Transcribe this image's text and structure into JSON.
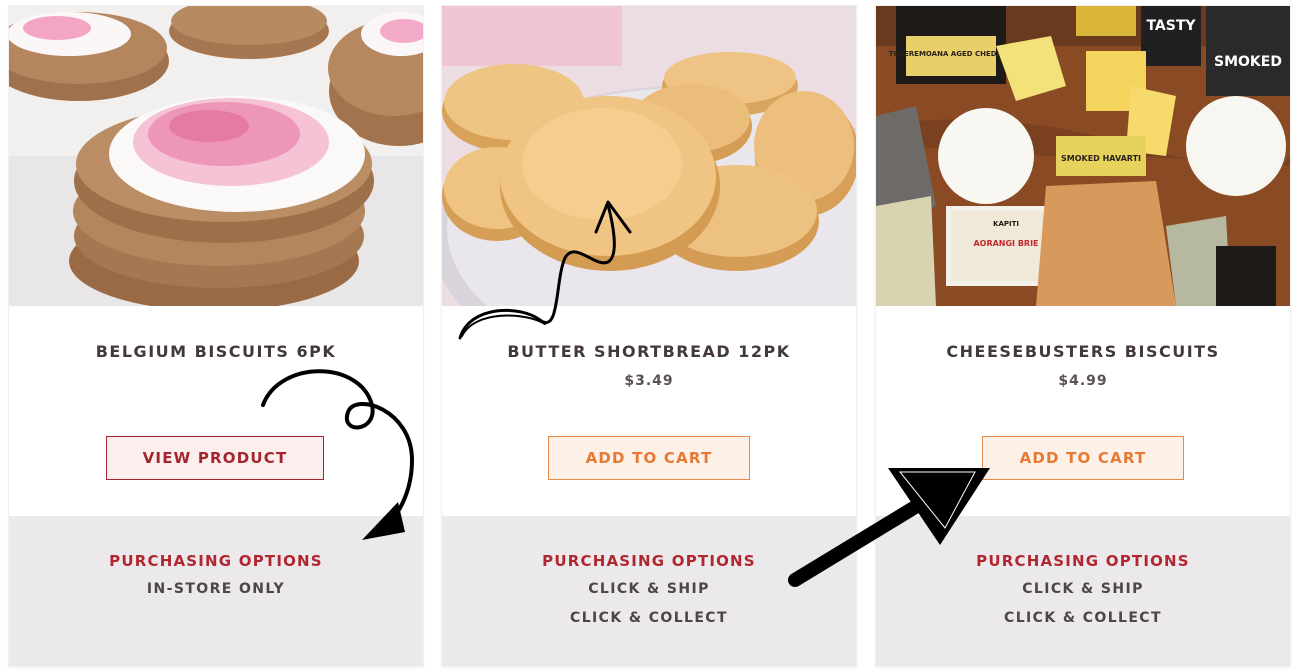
{
  "products": [
    {
      "name": "BELGIUM BISCUITS 6PK",
      "price": "",
      "button_label": "VIEW PRODUCT",
      "options_heading": "PURCHASING OPTIONS",
      "options": [
        "IN-STORE ONLY"
      ]
    },
    {
      "name": "BUTTER SHORTBREAD 12PK",
      "price": "$3.49",
      "button_label": "ADD TO CART",
      "options_heading": "PURCHASING OPTIONS",
      "options": [
        "CLICK & SHIP",
        "CLICK & COLLECT"
      ]
    },
    {
      "name": "CHEESEBUSTERS BISCUITS",
      "price": "$4.99",
      "button_label": "ADD TO CART",
      "options_heading": "PURCHASING OPTIONS",
      "options": [
        "CLICK & SHIP",
        "CLICK & COLLECT"
      ]
    }
  ],
  "image_labels": {
    "cheese_1": "TUTEREMOANA AGED CHEDDAR",
    "cheese_2": "SMOKED HAVARTI",
    "cheese_3": "AORANGI BRIE",
    "brand": "KAPITI",
    "box_1": "TASTY",
    "box_2": "SMOKED"
  },
  "colors": {
    "text_dark": "#43393a",
    "view_button": "#a3262e",
    "cart_button": "#e67a34",
    "options_heading": "#b1272f",
    "options_bg": "#ebe9ec"
  }
}
